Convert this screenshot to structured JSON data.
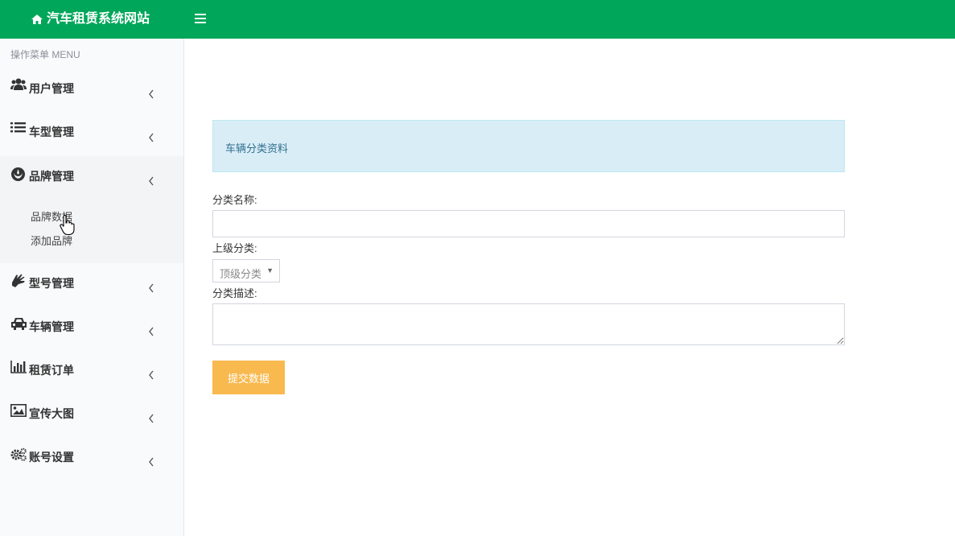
{
  "header": {
    "title": "汽车租赁系统网站",
    "home_icon": "home-icon",
    "menu_icon": "bars-icon",
    "color": "#00a65a"
  },
  "sidebar": {
    "header": "操作菜单 MENU",
    "items": [
      {
        "label": "用户管理",
        "icon": "users-icon"
      },
      {
        "label": "车型管理",
        "icon": "list-icon"
      },
      {
        "label": "品牌管理",
        "icon": "rebel-icon",
        "expanded": true,
        "children": [
          {
            "label": "品牌数据"
          },
          {
            "label": "添加品牌"
          }
        ]
      },
      {
        "label": "型号管理",
        "icon": "hand-icon"
      },
      {
        "label": "车辆管理",
        "icon": "car-icon"
      },
      {
        "label": "租赁订单",
        "icon": "bar-chart-icon"
      },
      {
        "label": "宣传大图",
        "icon": "image-icon"
      },
      {
        "label": "账号设置",
        "icon": "cogs-icon"
      }
    ]
  },
  "panel": {
    "title": "车辆分类资料"
  },
  "form": {
    "name_label": "分类名称:",
    "name_value": "",
    "parent_label": "上级分类:",
    "parent_value": "顶级分类",
    "desc_label": "分类描述:",
    "desc_value": "",
    "submit_label": "提交数据",
    "submit_color": "#f8b94f"
  }
}
